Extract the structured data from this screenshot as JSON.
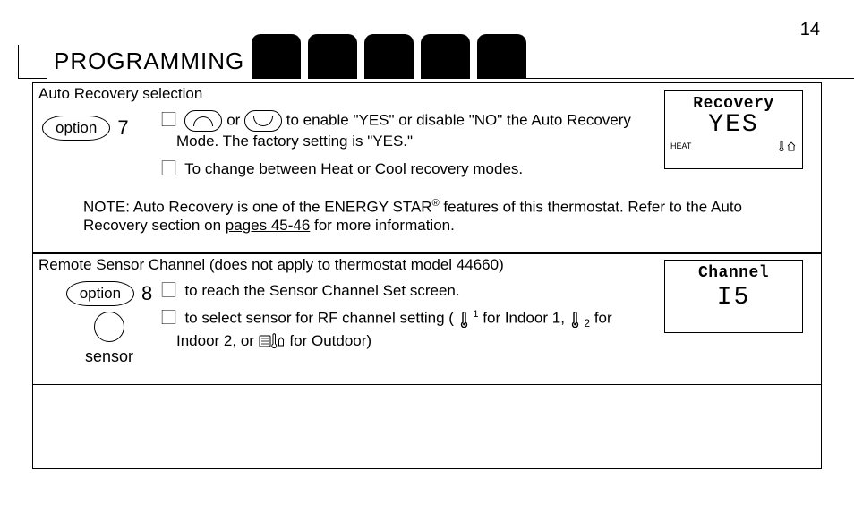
{
  "page": {
    "number": "14",
    "title": "PROGRAMMING"
  },
  "section1": {
    "title": "Auto Recovery selection",
    "option_label": "option",
    "option_number": "7",
    "line1_or": "or",
    "line1_text": "to enable \"YES\" or disable \"NO\" the Auto Recovery Mode. The factory setting is \"YES.\"",
    "line2_text": "To change between Heat or Cool recovery modes.",
    "note_prefix": "NOTE: Auto Recovery is one of the ENERGY STAR",
    "note_reg": "®",
    "note_suffix": " features of this thermostat. Refer to the Auto Recovery section on ",
    "note_pages_link": "pages 45-46",
    "note_tail": " for more information.",
    "lcd": {
      "line1": "Recovery",
      "line2": "YES",
      "heat": "HEAT"
    }
  },
  "section2": {
    "title": "Remote Sensor Channel (does not apply to thermostat model 44660)",
    "option_label": "option",
    "option_number": "8",
    "line1_text": "to reach the Sensor Channel Set screen.",
    "line2_a": "to select sensor for RF channel setting (",
    "line2_b": " for Indoor 1,",
    "line2_c": " for Indoor 2, or",
    "line2_d": " for Outdoor)",
    "sensor_label": "sensor",
    "lcd": {
      "line1": "Channel",
      "line2": "I5"
    },
    "therm1_sup": "1",
    "therm2_sub": "2"
  }
}
